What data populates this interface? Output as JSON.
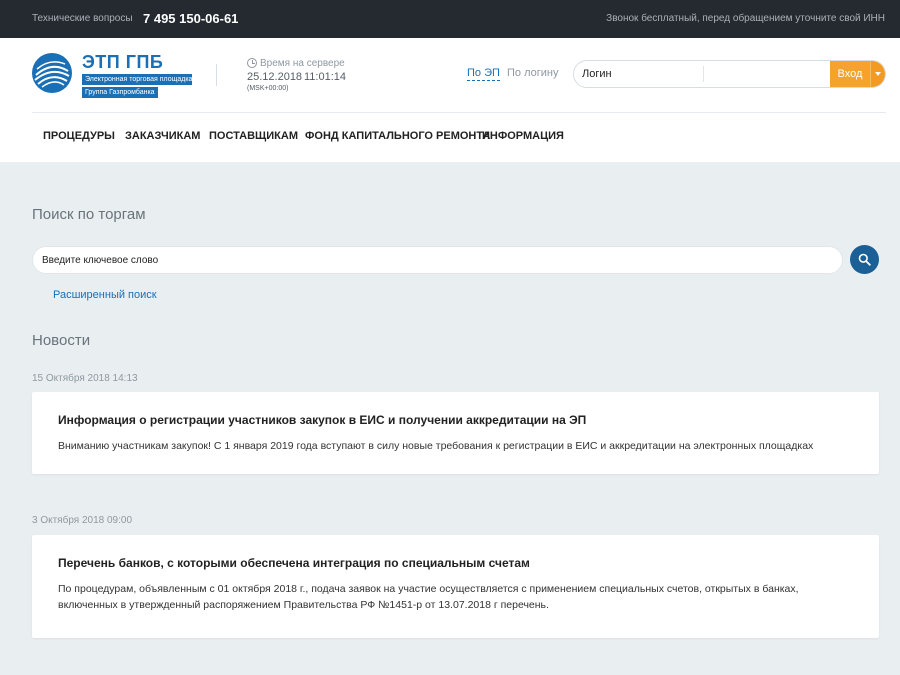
{
  "topbar": {
    "support_label": "Технические вопросы",
    "phone": "7 495 150-06-61",
    "call_note": "Звонок бесплатный, перед обращением уточните свой ИНН"
  },
  "logo": {
    "title": "ЭТП ГПБ",
    "subtitle1": "Электронная торговая площадка",
    "subtitle2": "Группа Газпромбанка"
  },
  "server_time": {
    "label": "Время на сервере",
    "date": "25.12.2018",
    "time": "11:01:14",
    "timezone": "(MSK+00:00)"
  },
  "auth": {
    "tab_ep": "По ЭП",
    "tab_login": "По логину",
    "login_placeholder": "Логин",
    "login_button": "Вход"
  },
  "nav": {
    "items": [
      "ПРОЦЕДУРЫ",
      "ЗАКАЗЧИКАМ",
      "ПОСТАВЩИКАМ",
      "ФОНД КАПИТАЛЬНОГО РЕМОНТА",
      "ИНФОРМАЦИЯ"
    ]
  },
  "search": {
    "heading": "Поиск по торгам",
    "placeholder": "Введите ключевое слово",
    "advanced_link": "Расширенный поиск"
  },
  "news": {
    "heading": "Новости",
    "items": [
      {
        "date": "15 Октября 2018 14:13",
        "title": "Информация о регистрации участников закупок в ЕИС и получении аккредитации на ЭП",
        "text": "Вниманию участникам закупок! С 1 января 2019 года вступают в силу новые требования к регистрации в ЕИС и аккредитации на электронных площадках"
      },
      {
        "date": "3 Октября 2018 09:00",
        "title": "Перечень банков, с которыми обеспечена интеграция по специальным счетам",
        "text": "По процедурам, объявленным с 01 октября 2018 г., подача заявок на участие осуществляется с применением специальных счетов, открытых в банках, включенных в утвержденный распоряжением Правительства РФ №1451-р от 13.07.2018 г перечень."
      }
    ]
  },
  "colors": {
    "brand_blue": "#1a6fb5",
    "accent_orange": "#f6a22f",
    "topbar_bg": "#252a31",
    "page_bg": "#e9eef1"
  }
}
